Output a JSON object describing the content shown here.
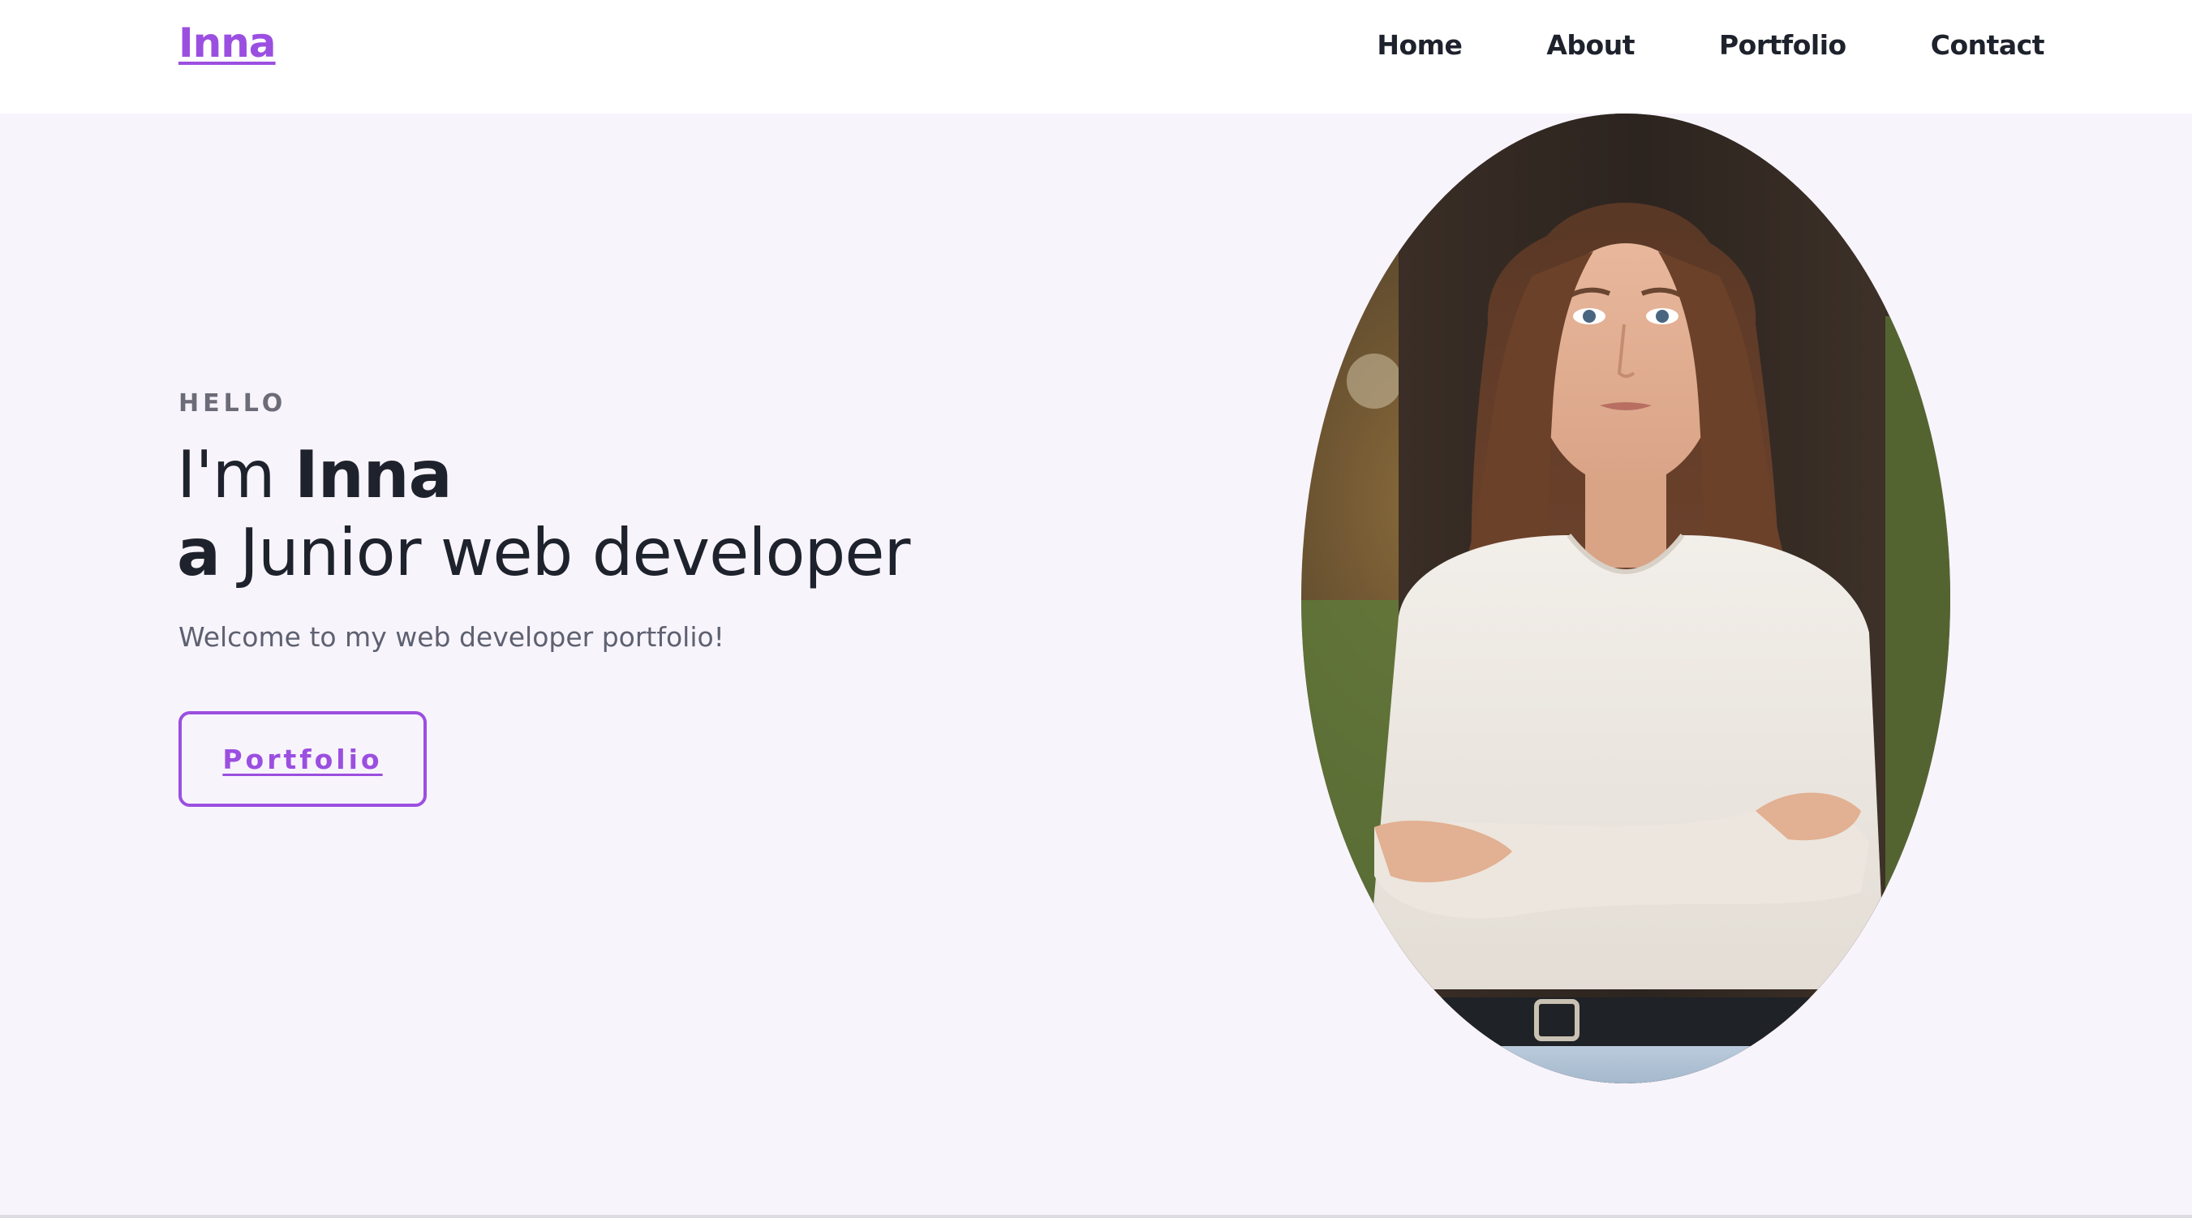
{
  "header": {
    "logo": "Inna",
    "nav": [
      "Home",
      "About",
      "Portfolio",
      "Contact"
    ]
  },
  "hero": {
    "eyebrow": "HELLO",
    "line1_prefix": "I'm ",
    "line1_name": "Inna",
    "line2_article": "a",
    "line2_role": " Junior web developer",
    "subtitle": "Welcome to my web developer portfolio!",
    "cta_label": "Portfolio"
  },
  "portrait": {
    "description_icon": "profile-photo"
  },
  "colors": {
    "accent": "#9b4fe0",
    "text_dark": "#1e222c",
    "text_muted": "#5d6170",
    "eyebrow": "#6c6c78",
    "hero_bg": "#f8f4fc"
  }
}
